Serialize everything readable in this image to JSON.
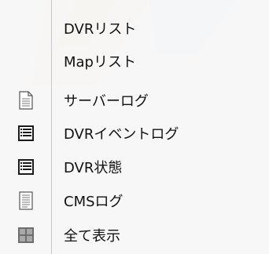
{
  "menu": {
    "items": [
      {
        "label": "DVRリスト",
        "icon": ""
      },
      {
        "label": "Mapリスト",
        "icon": ""
      },
      {
        "label": "サーバーログ",
        "icon": "document-icon"
      },
      {
        "label": "DVRイベントログ",
        "icon": "list-icon"
      },
      {
        "label": "DVR状態",
        "icon": "list-icon"
      },
      {
        "label": "CMSログ",
        "icon": "document-lines-icon"
      },
      {
        "label": "全て表示",
        "icon": "grid-icon"
      }
    ]
  },
  "colors": {
    "logo_orange": "#f4a835",
    "logo_blue": "#3a6fc4",
    "icon_dark": "#1a1a1a",
    "grid_icon": "#6e6e6e"
  }
}
